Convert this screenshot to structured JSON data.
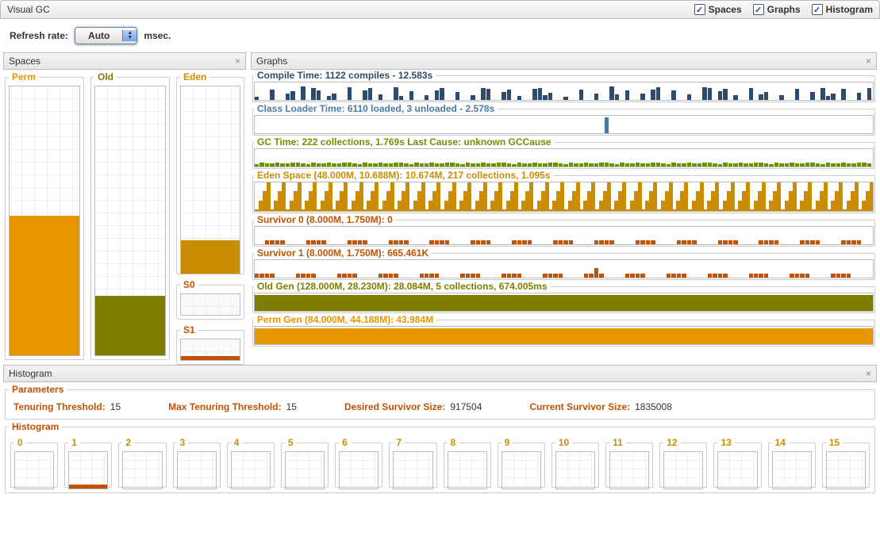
{
  "app": {
    "title": "Visual GC"
  },
  "toggles": {
    "spaces": "Spaces",
    "graphs": "Graphs",
    "histogram": "Histogram"
  },
  "refresh": {
    "label": "Refresh rate:",
    "value": "Auto",
    "unit": "msec."
  },
  "panels": {
    "spaces": "Spaces",
    "graphs": "Graphs",
    "histogram": "Histogram"
  },
  "spaces": {
    "perm": {
      "label": "Perm"
    },
    "old": {
      "label": "Old"
    },
    "eden": {
      "label": "Eden"
    },
    "s0": {
      "label": "S0"
    },
    "s1": {
      "label": "S1"
    }
  },
  "graphs": {
    "compile": "Compile Time: 1122 compiles - 12.583s",
    "classloader": "Class Loader Time: 6110 loaded, 3 unloaded - 2.578s",
    "gc": "GC Time: 222 collections, 1.769s  Last Cause: unknown GCCause",
    "eden": "Eden Space (48.000M, 10.688M): 10.674M, 217 collections, 1.095s",
    "s0": "Survivor 0 (8.000M, 1.750M): 0",
    "s1": "Survivor 1 (8.000M, 1.750M): 665.461K",
    "old": "Old Gen (128.000M, 28.230M): 28.084M, 5 collections, 674.005ms",
    "perm": "Perm Gen (84.000M, 44.188M): 43.984M"
  },
  "params": {
    "tenuring_threshold_label": "Tenuring Threshold:",
    "tenuring_threshold": "15",
    "max_tenuring_label": "Max Tenuring Threshold:",
    "max_tenuring": "15",
    "desired_label": "Desired Survivor Size:",
    "desired": "917504",
    "current_label": "Current Survivor Size:",
    "current": "1835008",
    "parameters_legend": "Parameters",
    "histogram_legend": "Histogram"
  },
  "hist_bins": [
    "0",
    "1",
    "2",
    "3",
    "4",
    "5",
    "6",
    "7",
    "8",
    "9",
    "10",
    "11",
    "12",
    "13",
    "14",
    "15"
  ],
  "chart_data": {
    "type": "bar",
    "title": "Visual GC memory spaces and GC graphs",
    "spaces": [
      {
        "name": "Perm",
        "capacity_M": 84.0,
        "used_M": 43.984,
        "fill_pct": 52
      },
      {
        "name": "Old",
        "capacity_M": 128.0,
        "used_M": 28.084,
        "fill_pct": 22
      },
      {
        "name": "Eden",
        "capacity_M": 48.0,
        "used_M": 10.674,
        "fill_pct": 22
      },
      {
        "name": "S0",
        "capacity_M": 8.0,
        "used_M": 0,
        "fill_pct": 0
      },
      {
        "name": "S1",
        "capacity_M": 8.0,
        "used_M": 0.665,
        "fill_pct": 8
      }
    ],
    "histogram_bins": {
      "categories": [
        "0",
        "1",
        "2",
        "3",
        "4",
        "5",
        "6",
        "7",
        "8",
        "9",
        "10",
        "11",
        "12",
        "13",
        "14",
        "15"
      ],
      "values": [
        0,
        1,
        0,
        0,
        0,
        0,
        0,
        0,
        0,
        0,
        0,
        0,
        0,
        0,
        0,
        0
      ]
    }
  }
}
